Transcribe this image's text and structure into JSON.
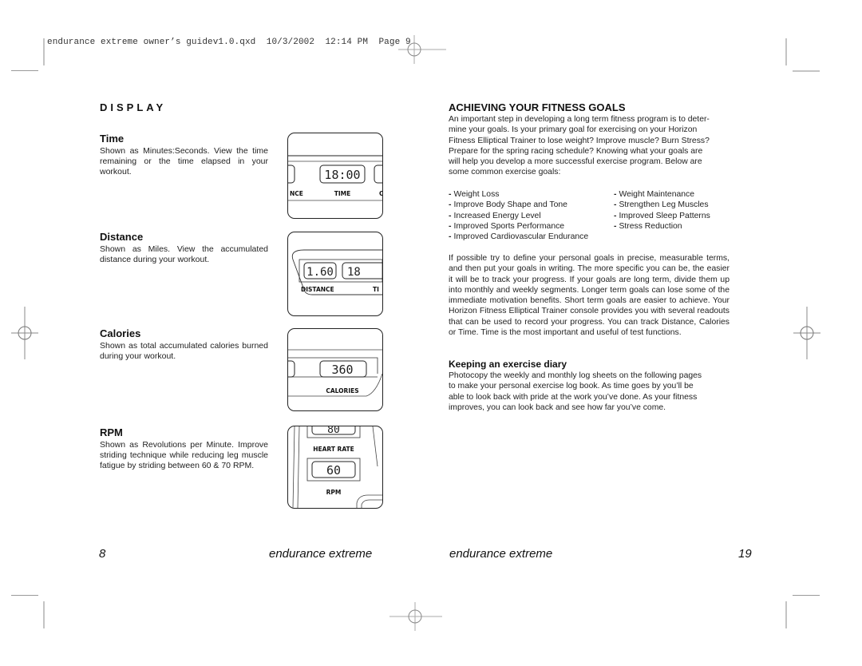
{
  "slug_line": "endurance extreme owner’s guidev1.0.qxd  10/3/2002  12:14 PM  Page 9",
  "left_page": {
    "section_title": "DISPLAY",
    "items": [
      {
        "title": "Time",
        "description": "Shown as Minutes:Seconds. View the time remaining or the time elapsed in your workout.",
        "console": {
          "readout": "18:00",
          "label": "TIME",
          "left_partial_label": "NCE",
          "right_partial_label": "C"
        }
      },
      {
        "title": "Distance",
        "description": "Shown as Miles. View the accumulated distance during your workout.",
        "console": {
          "readout": "1.60",
          "label": "DISTANCE",
          "right_partial_readout": "18",
          "right_partial_label": "TI"
        }
      },
      {
        "title": "Calories",
        "description": "Shown as total accumulated calories burned during your workout.",
        "console": {
          "readout": "360",
          "label": "CALORIES"
        }
      },
      {
        "title": "RPM",
        "description": "Shown as Revolutions per Minute. Improve striding technique while reducing leg muscle fatigue by striding between 60 & 70 RPM.",
        "console": {
          "top_readout": "80",
          "top_label": "HEART RATE",
          "readout": "60",
          "label": "RPM"
        }
      }
    ],
    "page_number": "8",
    "footer_title": "endurance extreme"
  },
  "right_page": {
    "heading": "ACHIEVING YOUR FITNESS GOALS",
    "intro": "An important step in developing a long term fitness program is to determine your goals. Is your primary goal for exercising on your Horizon Fitness Elliptical Trainer to lose weight? Improve muscle? Burn Stress? Prepare for the spring racing schedule? Knowing what your goals are will help you develop a more successful exercise program. Below are some common exercise goals:",
    "intro_lines": [
      "An important step in developing a long term fitness program is to deter-",
      "mine your goals. Is your primary goal for exercising on your Horizon",
      "Fitness Elliptical Trainer to lose weight? Improve muscle? Burn Stress?",
      "Prepare for the spring racing schedule? Knowing what your goals are",
      "will help you develop a more successful exercise program. Below are",
      "some common exercise goals:"
    ],
    "goals_column_1": [
      "Weight Loss",
      "Improve Body Shape and Tone",
      "Increased Energy Level",
      "Improved Sports Performance",
      "Improved Cardiovascular Endurance"
    ],
    "goals_column_2": [
      "Weight Maintenance",
      "Strengthen Leg Muscles",
      "Improved Sleep Patterns",
      "Stress Reduction"
    ],
    "bullet": "-",
    "paragraph": "If possible try to define your personal goals in precise, measurable terms, and then put your goals in writing. The more specific you can be, the easier it will be to track your progress. If your goals are long term, divide them up into monthly and weekly segments. Longer term goals can lose some of the immediate motivation benefits. Short term goals are easier to achieve. Your Horizon Fitness Elliptical Trainer console provides you with several readouts that can be used to record your progress. You can track Distance, Calories or Time. Time is the most important and useful of test functions.",
    "diary_heading": "Keeping an exercise diary",
    "diary_lines": [
      "Photocopy the weekly and monthly log sheets on the following pages",
      "to make your personal exercise log book. As time goes by you’ll be",
      "able to look back with pride at the work you’ve done. As your fitness",
      "improves, you can look back and see how far you’ve come."
    ],
    "footer_title": "endurance extreme",
    "page_number": "19"
  },
  "colors": {
    "text": "#111111",
    "crop_mark": "#9a9a9a",
    "crop_mark_light": "#c4c4c4"
  }
}
